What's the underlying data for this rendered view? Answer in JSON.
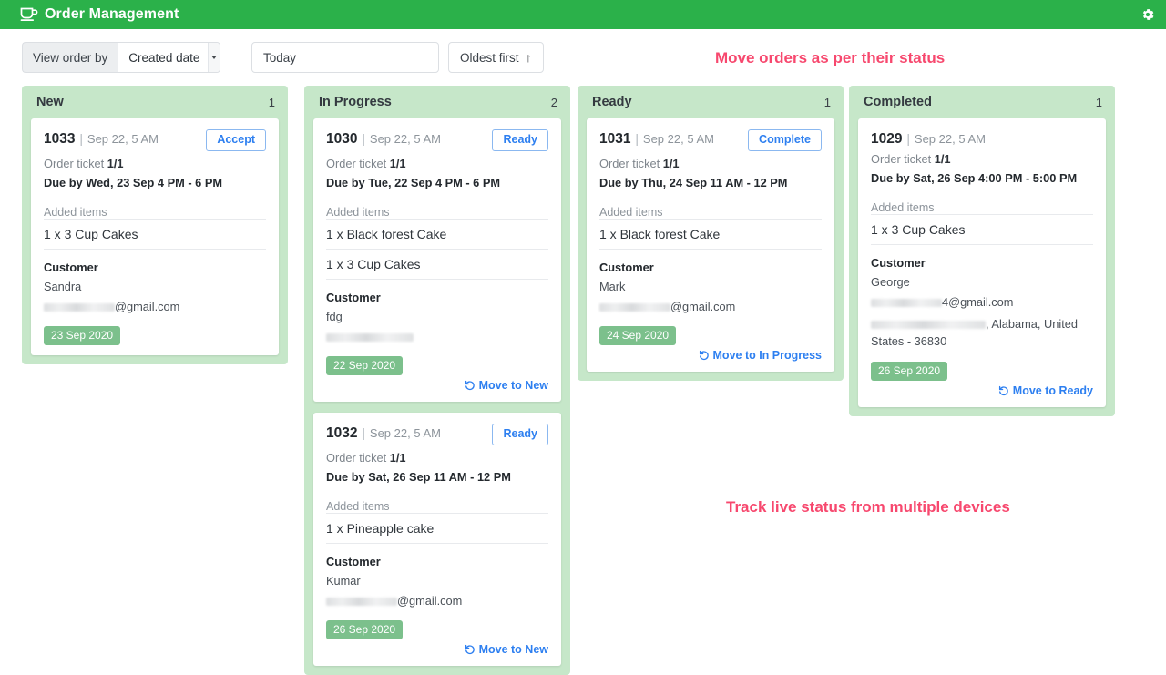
{
  "appbar": {
    "title": "Order Management",
    "logo_icon": "coffee-cup-icon",
    "settings_icon": "gear-icon",
    "background_color": "#2bb14a"
  },
  "toolbar": {
    "view_order_by_label": "View order by",
    "sort_field_value": "Created date",
    "date_filter_value": "Today",
    "sort_direction_label": "Oldest first",
    "sort_direction_icon": "arrow-up-icon"
  },
  "annotations": {
    "top": "Move orders as per their status",
    "bottom": "Track live status from multiple devices",
    "color": "#f7486e"
  },
  "board": {
    "column_background": "#c6e7c9",
    "date_badge_color": "#7cc08c",
    "accent_link_color": "#2d7ff0",
    "columns": [
      {
        "title": "New",
        "count": "1",
        "cards": [
          {
            "order_id": "1033",
            "separator": "|",
            "created": "Sep 22, 5 AM",
            "action_label": "Accept",
            "ticket_label": "Order ticket",
            "ticket_value": "1/1",
            "due": "Due by Wed, 23 Sep 4 PM - 6 PM",
            "added_items_label": "Added items",
            "items": [
              "1 x 3 Cup Cakes"
            ],
            "customer_label": "Customer",
            "customer_name": "Sandra",
            "email_suffix": "@gmail.com",
            "address": "",
            "date_badge": "23 Sep 2020",
            "move_label": "",
            "move_icon": ""
          }
        ]
      },
      {
        "title": "In Progress",
        "count": "2",
        "cards": [
          {
            "order_id": "1030",
            "separator": "|",
            "created": "Sep 22, 5 AM",
            "action_label": "Ready",
            "ticket_label": "Order ticket",
            "ticket_value": "1/1",
            "due": "Due by Tue, 22 Sep 4 PM - 6 PM",
            "added_items_label": "Added items",
            "items": [
              "1 x Black forest Cake",
              "1 x 3 Cup Cakes"
            ],
            "customer_label": "Customer",
            "customer_name": "fdg",
            "email_suffix": "",
            "address": "",
            "date_badge": "22 Sep 2020",
            "move_label": "Move to New",
            "move_icon": "undo-arrow-icon"
          },
          {
            "order_id": "1032",
            "separator": "|",
            "created": "Sep 22, 5 AM",
            "action_label": "Ready",
            "ticket_label": "Order ticket",
            "ticket_value": "1/1",
            "due": "Due by Sat, 26 Sep 11 AM - 12 PM",
            "added_items_label": "Added items",
            "items": [
              "1 x Pineapple cake"
            ],
            "customer_label": "Customer",
            "customer_name": "Kumar",
            "email_suffix": "@gmail.com",
            "address": "",
            "date_badge": "26 Sep 2020",
            "move_label": "Move to New",
            "move_icon": "undo-arrow-icon"
          }
        ]
      },
      {
        "title": "Ready",
        "count": "1",
        "cards": [
          {
            "order_id": "1031",
            "separator": "|",
            "created": "Sep 22, 5 AM",
            "action_label": "Complete",
            "ticket_label": "Order ticket",
            "ticket_value": "1/1",
            "due": "Due by Thu, 24 Sep 11 AM - 12 PM",
            "added_items_label": "Added items",
            "items": [
              "1 x Black forest Cake"
            ],
            "customer_label": "Customer",
            "customer_name": "Mark",
            "email_suffix": "@gmail.com",
            "address": "",
            "date_badge": "24 Sep 2020",
            "move_label": "Move to In Progress",
            "move_icon": "undo-arrow-icon"
          }
        ]
      },
      {
        "title": "Completed",
        "count": "1",
        "cards": [
          {
            "order_id": "1029",
            "separator": "|",
            "created": "Sep 22, 5 AM",
            "action_label": "",
            "ticket_label": "Order ticket",
            "ticket_value": "1/1",
            "due": "Due by Sat, 26 Sep 4:00 PM - 5:00 PM",
            "added_items_label": "Added items",
            "items": [
              "1 x 3 Cup Cakes"
            ],
            "customer_label": "Customer",
            "customer_name": "George",
            "email_suffix": "4@gmail.com",
            "address": ", Alabama, United States - 36830",
            "date_badge": "26 Sep 2020",
            "move_label": "Move to Ready",
            "move_icon": "undo-arrow-icon"
          }
        ]
      }
    ]
  }
}
